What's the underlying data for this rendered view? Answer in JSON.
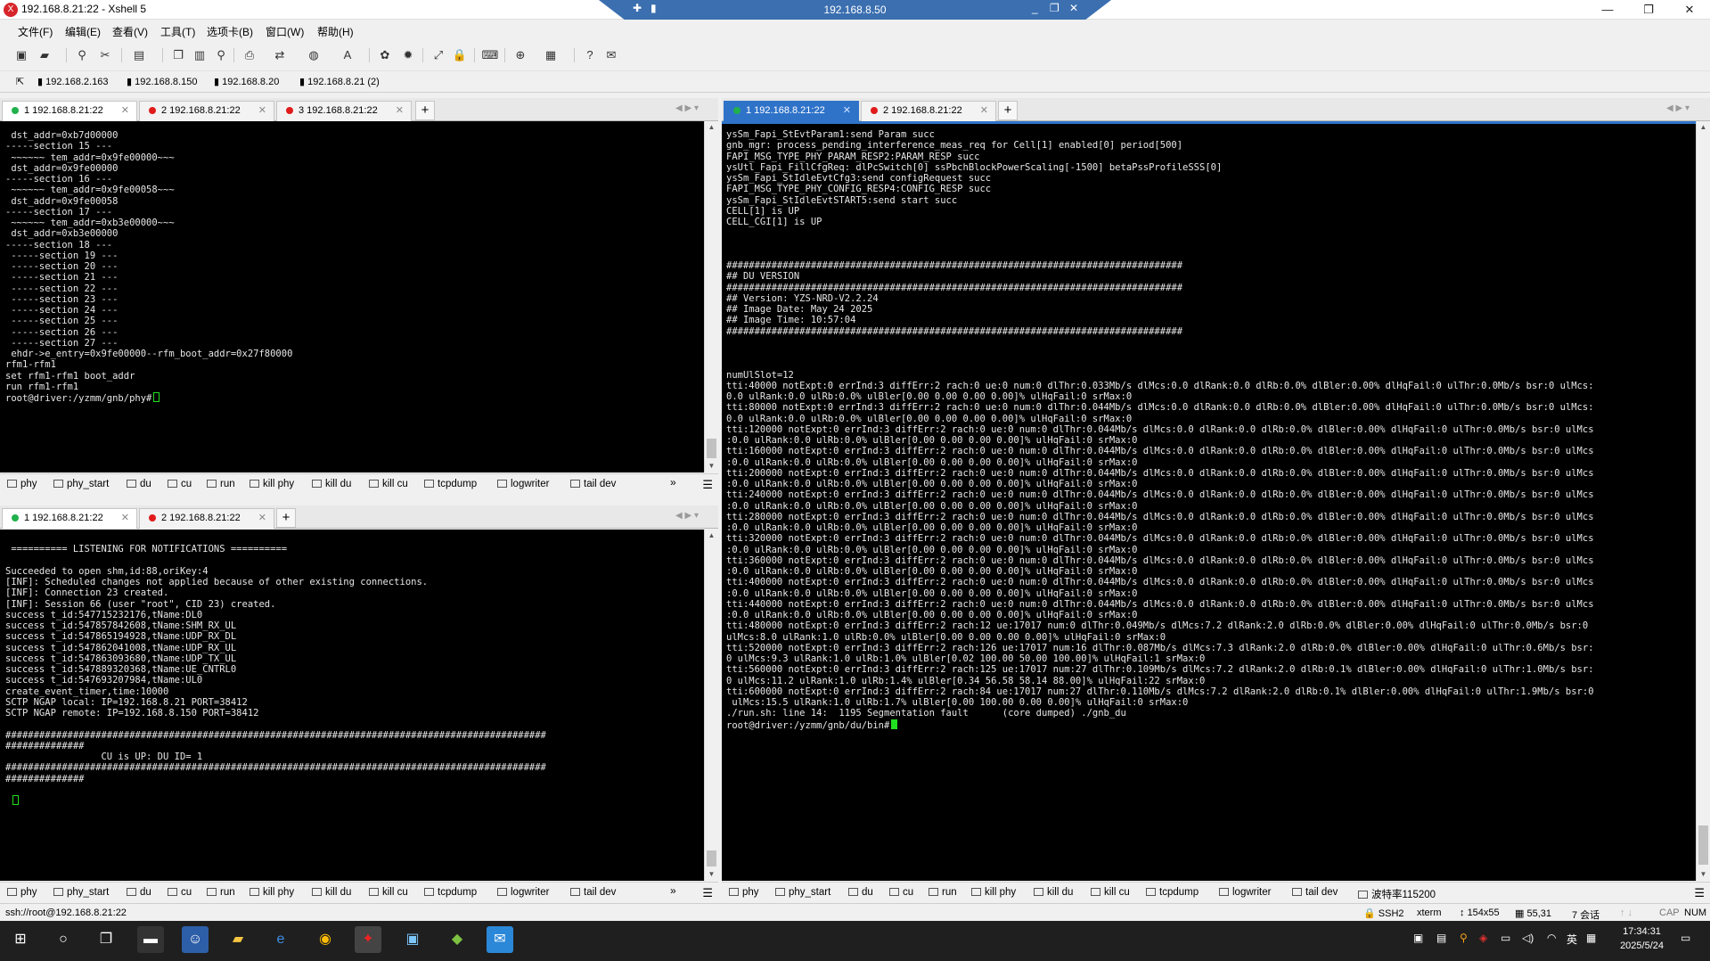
{
  "window": {
    "title": "192.168.8.21:22 - Xshell 5",
    "remote_title": "192.168.8.50",
    "minimize": "—",
    "maximize": "❐",
    "close": "✕"
  },
  "menu": [
    "文件(F)",
    "编辑(E)",
    "查看(V)",
    "工具(T)",
    "选项卡(B)",
    "窗口(W)",
    "帮助(H)"
  ],
  "bookmarks": [
    "192.168.2.163",
    "192.168.8.150",
    "192.168.8.20",
    "192.168.8.21 (2)"
  ],
  "panes": {
    "top_left": {
      "tabs": [
        "1 192.168.8.21:22",
        "2 192.168.8.21:22",
        "3 192.168.8.21:22"
      ],
      "lines": [
        " dst_addr=0xb7d00000",
        "-----section 15 ---",
        " ~~~~~~ tem_addr=0x9fe00000~~~",
        " dst_addr=0x9fe00000",
        "-----section 16 ---",
        " ~~~~~~ tem_addr=0x9fe00058~~~",
        " dst_addr=0x9fe00058",
        "-----section 17 ---",
        " ~~~~~~ tem_addr=0xb3e00000~~~",
        " dst_addr=0xb3e00000",
        "-----section 18 ---",
        " -----section 19 ---",
        " -----section 20 ---",
        " -----section 21 ---",
        " -----section 22 ---",
        " -----section 23 ---",
        " -----section 24 ---",
        " -----section 25 ---",
        " -----section 26 ---",
        " -----section 27 ---",
        " ehdr->e_entry=0x9fe00000--rfm_boot_addr=0x27f80000",
        "rfm1-rfm1",
        "set rfm1-rfm1 boot_addr",
        "run rfm1-rfm1",
        "root@driver:/yzmm/gnb/phy#"
      ]
    },
    "bottom_left": {
      "tabs": [
        "1 192.168.8.21:22",
        "2 192.168.8.21:22"
      ],
      "lines": [
        "",
        " ========== LISTENING FOR NOTIFICATIONS ==========",
        "",
        "Succeeded to open shm,id:88,oriKey:4",
        "[INF]: Scheduled changes not applied because of other existing connections.",
        "[INF]: Connection 23 created.",
        "[INF]: Session 66 (user \"root\", CID 23) created.",
        "success t_id:547715232176,tName:DL0",
        "success t_id:547857842608,tName:SHM_RX_UL",
        "success t_id:547865194928,tName:UDP_RX_DL",
        "success t_id:547862041008,tName:UDP_RX_UL",
        "success t_id:547863093680,tName:UDP_TX_UL",
        "success t_id:547889320368,tName:UE_CNTRL0",
        "success t_id:547693207984,tName:UL0",
        "create_event_timer,time:10000",
        "SCTP NGAP local: IP=192.168.8.21 PORT=38412",
        "SCTP NGAP remote: IP=192.168.8.150 PORT=38412",
        "",
        "################################################################################################",
        "##############",
        "                 CU is UP: DU ID= 1",
        "################################################################################################",
        "##############",
        "",
        ""
      ]
    },
    "right": {
      "tabs": [
        "1 192.168.8.21:22",
        "2 192.168.8.21:22"
      ],
      "lines": [
        "ysSm_Fapi_StEvtParam1:send Param succ",
        "gnb_mgr: process_pending_interference_meas_req for Cell[1] enabled[0] period[500]",
        "FAPI_MSG_TYPE_PHY_PARAM_RESP2:PARAM_RESP succ",
        "ysUtl_Fapi_FillCfgReq: dlPcSwitch[0] ssPbchBlockPowerScaling[-1500] betaPssProfileSSS[0]",
        "ysSm_Fapi_StIdleEvtCfg3:send configRequest succ",
        "FAPI_MSG_TYPE_PHY_CONFIG_RESP4:CONFIG_RESP succ",
        "ysSm_Fapi_StIdleEvtSTART5:send start succ",
        "CELL[1] is UP",
        "CELL_CGI[1] is UP",
        "",
        "",
        "",
        "#################################################################################",
        "## DU VERSION",
        "#################################################################################",
        "## Version: YZS-NRD-V2.2.24",
        "## Image Date: May 24 2025",
        "## Image Time: 10:57:04",
        "#################################################################################",
        "",
        "",
        "",
        "numUlSlot=12",
        "tti:40000 notExpt:0 errInd:3 diffErr:2 rach:0 ue:0 num:0 dlThr:0.033Mb/s dlMcs:0.0 dlRank:0.0 dlRb:0.0% dlBler:0.00% dlHqFail:0 ulThr:0.0Mb/s bsr:0 ulMcs:",
        "0.0 ulRank:0.0 ulRb:0.0% ulBler[0.00 0.00 0.00 0.00]% ulHqFail:0 srMax:0",
        "tti:80000 notExpt:0 errInd:3 diffErr:2 rach:0 ue:0 num:0 dlThr:0.044Mb/s dlMcs:0.0 dlRank:0.0 dlRb:0.0% dlBler:0.00% dlHqFail:0 ulThr:0.0Mb/s bsr:0 ulMcs:",
        "0.0 ulRank:0.0 ulRb:0.0% ulBler[0.00 0.00 0.00 0.00]% ulHqFail:0 srMax:0",
        "tti:120000 notExpt:0 errInd:3 diffErr:2 rach:0 ue:0 num:0 dlThr:0.044Mb/s dlMcs:0.0 dlRank:0.0 dlRb:0.0% dlBler:0.00% dlHqFail:0 ulThr:0.0Mb/s bsr:0 ulMcs",
        ":0.0 ulRank:0.0 ulRb:0.0% ulBler[0.00 0.00 0.00 0.00]% ulHqFail:0 srMax:0",
        "tti:160000 notExpt:0 errInd:3 diffErr:2 rach:0 ue:0 num:0 dlThr:0.044Mb/s dlMcs:0.0 dlRank:0.0 dlRb:0.0% dlBler:0.00% dlHqFail:0 ulThr:0.0Mb/s bsr:0 ulMcs",
        ":0.0 ulRank:0.0 ulRb:0.0% ulBler[0.00 0.00 0.00 0.00]% ulHqFail:0 srMax:0",
        "tti:200000 notExpt:0 errInd:3 diffErr:2 rach:0 ue:0 num:0 dlThr:0.044Mb/s dlMcs:0.0 dlRank:0.0 dlRb:0.0% dlBler:0.00% dlHqFail:0 ulThr:0.0Mb/s bsr:0 ulMcs",
        ":0.0 ulRank:0.0 ulRb:0.0% ulBler[0.00 0.00 0.00 0.00]% ulHqFail:0 srMax:0",
        "tti:240000 notExpt:0 errInd:3 diffErr:2 rach:0 ue:0 num:0 dlThr:0.044Mb/s dlMcs:0.0 dlRank:0.0 dlRb:0.0% dlBler:0.00% dlHqFail:0 ulThr:0.0Mb/s bsr:0 ulMcs",
        ":0.0 ulRank:0.0 ulRb:0.0% ulBler[0.00 0.00 0.00 0.00]% ulHqFail:0 srMax:0",
        "tti:280000 notExpt:0 errInd:3 diffErr:2 rach:0 ue:0 num:0 dlThr:0.044Mb/s dlMcs:0.0 dlRank:0.0 dlRb:0.0% dlBler:0.00% dlHqFail:0 ulThr:0.0Mb/s bsr:0 ulMcs",
        ":0.0 ulRank:0.0 ulRb:0.0% ulBler[0.00 0.00 0.00 0.00]% ulHqFail:0 srMax:0",
        "tti:320000 notExpt:0 errInd:3 diffErr:2 rach:0 ue:0 num:0 dlThr:0.044Mb/s dlMcs:0.0 dlRank:0.0 dlRb:0.0% dlBler:0.00% dlHqFail:0 ulThr:0.0Mb/s bsr:0 ulMcs",
        ":0.0 ulRank:0.0 ulRb:0.0% ulBler[0.00 0.00 0.00 0.00]% ulHqFail:0 srMax:0",
        "tti:360000 notExpt:0 errInd:3 diffErr:2 rach:0 ue:0 num:0 dlThr:0.044Mb/s dlMcs:0.0 dlRank:0.0 dlRb:0.0% dlBler:0.00% dlHqFail:0 ulThr:0.0Mb/s bsr:0 ulMcs",
        ":0.0 ulRank:0.0 ulRb:0.0% ulBler[0.00 0.00 0.00 0.00]% ulHqFail:0 srMax:0",
        "tti:400000 notExpt:0 errInd:3 diffErr:2 rach:0 ue:0 num:0 dlThr:0.044Mb/s dlMcs:0.0 dlRank:0.0 dlRb:0.0% dlBler:0.00% dlHqFail:0 ulThr:0.0Mb/s bsr:0 ulMcs",
        ":0.0 ulRank:0.0 ulRb:0.0% ulBler[0.00 0.00 0.00 0.00]% ulHqFail:0 srMax:0",
        "tti:440000 notExpt:0 errInd:3 diffErr:2 rach:0 ue:0 num:0 dlThr:0.044Mb/s dlMcs:0.0 dlRank:0.0 dlRb:0.0% dlBler:0.00% dlHqFail:0 ulThr:0.0Mb/s bsr:0 ulMcs",
        ":0.0 ulRank:0.0 ulRb:0.0% ulBler[0.00 0.00 0.00 0.00]% ulHqFail:0 srMax:0",
        "tti:480000 notExpt:0 errInd:3 diffErr:2 rach:12 ue:17017 num:0 dlThr:0.049Mb/s dlMcs:7.2 dlRank:2.0 dlRb:0.0% dlBler:0.00% dlHqFail:0 ulThr:0.0Mb/s bsr:0",
        "ulMcs:8.0 ulRank:1.0 ulRb:0.0% ulBler[0.00 0.00 0.00 0.00]% ulHqFail:0 srMax:0",
        "tti:520000 notExpt:0 errInd:3 diffErr:2 rach:126 ue:17017 num:16 dlThr:0.087Mb/s dlMcs:7.3 dlRank:2.0 dlRb:0.0% dlBler:0.00% dlHqFail:0 ulThr:0.6Mb/s bsr:",
        "0 ulMcs:9.3 ulRank:1.0 ulRb:1.0% ulBler[0.02 100.00 50.00 100.00]% ulHqFail:1 srMax:0",
        "tti:560000 notExpt:0 errInd:3 diffErr:2 rach:125 ue:17017 num:27 dlThr:0.109Mb/s dlMcs:7.2 dlRank:2.0 dlRb:0.1% dlBler:0.00% dlHqFail:0 ulThr:1.0Mb/s bsr:",
        "0 ulMcs:11.2 ulRank:1.0 ulRb:1.4% ulBler[0.34 56.58 58.14 88.00]% ulHqFail:22 srMax:0",
        "tti:600000 notExpt:0 errInd:3 diffErr:2 rach:84 ue:17017 num:27 dlThr:0.110Mb/s dlMcs:7.2 dlRank:2.0 dlRb:0.1% dlBler:0.00% dlHqFail:0 ulThr:1.9Mb/s bsr:0",
        " ulMcs:15.5 ulRank:1.0 ulRb:1.7% ulBler[0.00 100.00 0.00 0.00]% ulHqFail:0 srMax:0",
        "./run.sh: line 14:  1195 Segmentation fault      (core dumped) ./gnb_du",
        "root@driver:/yzmm/gnb/du/bin#"
      ]
    }
  },
  "quick_commands_left": [
    "phy",
    "phy_start",
    "du",
    "cu",
    "run",
    "kill phy",
    "kill du",
    "kill cu",
    "tcpdump",
    "logwriter",
    "tail dev"
  ],
  "quick_commands_right": [
    "phy",
    "phy_start",
    "du",
    "cu",
    "run",
    "kill phy",
    "kill du",
    "kill cu",
    "tcpdump",
    "logwriter",
    "tail dev",
    "波特率115200"
  ],
  "status": {
    "connection": "ssh://root@192.168.8.21:22",
    "protocol": "SSH2",
    "term": "xterm",
    "size": "154x55",
    "cursor_pos": "55,31",
    "sessions": "7 会话",
    "cap": "CAP",
    "num": "NUM"
  },
  "taskbar": {
    "time": "17:34:31",
    "date": "2025/5/24",
    "ime": "英"
  },
  "colors": {
    "accent": "#2f73c9",
    "session_active": "#21b14c",
    "session_inactive": "#e11b1b",
    "cursor": "#20e020"
  }
}
